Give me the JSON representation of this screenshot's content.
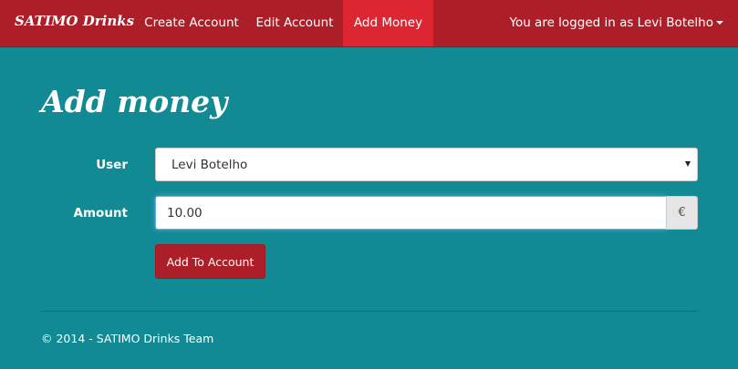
{
  "navbar": {
    "brand": "SATIMO Drinks",
    "items": [
      {
        "label": "Create Account",
        "active": false
      },
      {
        "label": "Edit Account",
        "active": false
      },
      {
        "label": "Add Money",
        "active": true
      }
    ],
    "user_menu": "You are logged in as Levi Botelho",
    "user_menu_icon": "caret-down-icon"
  },
  "main": {
    "title": "Add money",
    "form": {
      "user_label": "User",
      "user_selected": "Levi Botelho",
      "amount_label": "Amount",
      "amount_value": "10.00",
      "currency_symbol": "€",
      "submit_label": "Add To Account"
    }
  },
  "footer": {
    "text": "© 2014 - SATIMO Drinks Team"
  },
  "colors": {
    "navbar": "#ad1f28",
    "nav_active": "#dc2632",
    "background": "#128a93",
    "button": "#ad1f28"
  }
}
